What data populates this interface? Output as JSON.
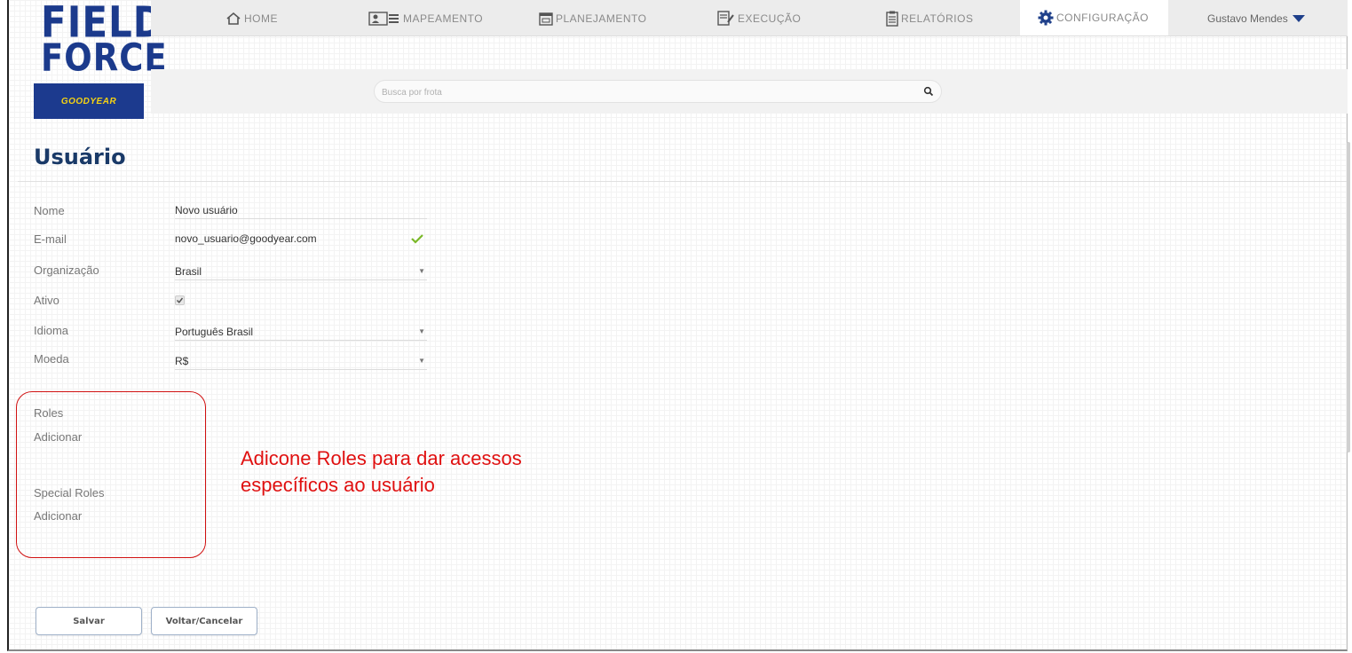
{
  "brand": {
    "logo_line1": "FIELD",
    "logo_line2": "FORCE",
    "partner": "GOODYEAR"
  },
  "nav": {
    "items": [
      {
        "label": "HOME",
        "icon": "home-icon"
      },
      {
        "label": "MAPEAMENTO",
        "icon": "id-card-icon"
      },
      {
        "label": "PLANEJAMENTO",
        "icon": "calendar-icon"
      },
      {
        "label": "EXECUÇÃO",
        "icon": "clipboard-edit-icon"
      },
      {
        "label": "RELATÓRIOS",
        "icon": "report-icon"
      },
      {
        "label": "CONFIGURAÇÃO",
        "icon": "gear-icon",
        "active": true
      }
    ],
    "user_name": "Gustavo Mendes"
  },
  "search": {
    "placeholder": "Busca por frota"
  },
  "page": {
    "title": "Usuário"
  },
  "form": {
    "nome": {
      "label": "Nome",
      "value": "Novo usuário"
    },
    "email": {
      "label": "E-mail",
      "value": "novo_usuario@goodyear.com",
      "valid": true
    },
    "organizacao": {
      "label": "Organização",
      "value": "Brasil"
    },
    "ativo": {
      "label": "Ativo",
      "checked": true
    },
    "idioma": {
      "label": "Idioma",
      "value": "Português Brasil"
    },
    "moeda": {
      "label": "Moeda",
      "value": "R$"
    }
  },
  "roles": {
    "roles_label": "Roles",
    "roles_add": "Adicionar",
    "special_label": "Special Roles",
    "special_add": "Adicionar"
  },
  "annotation": {
    "line1": "Adicone Roles para dar acessos",
    "line2": "específicos ao usuário"
  },
  "buttons": {
    "save": "Salvar",
    "cancel": "Voltar/Cancelar"
  },
  "colors": {
    "brand_blue": "#1b3a8c",
    "title_blue": "#1a3a68",
    "annotation_red": "#e01010",
    "check_green": "#7ab828",
    "goodyear_yellow": "#f6d312"
  }
}
